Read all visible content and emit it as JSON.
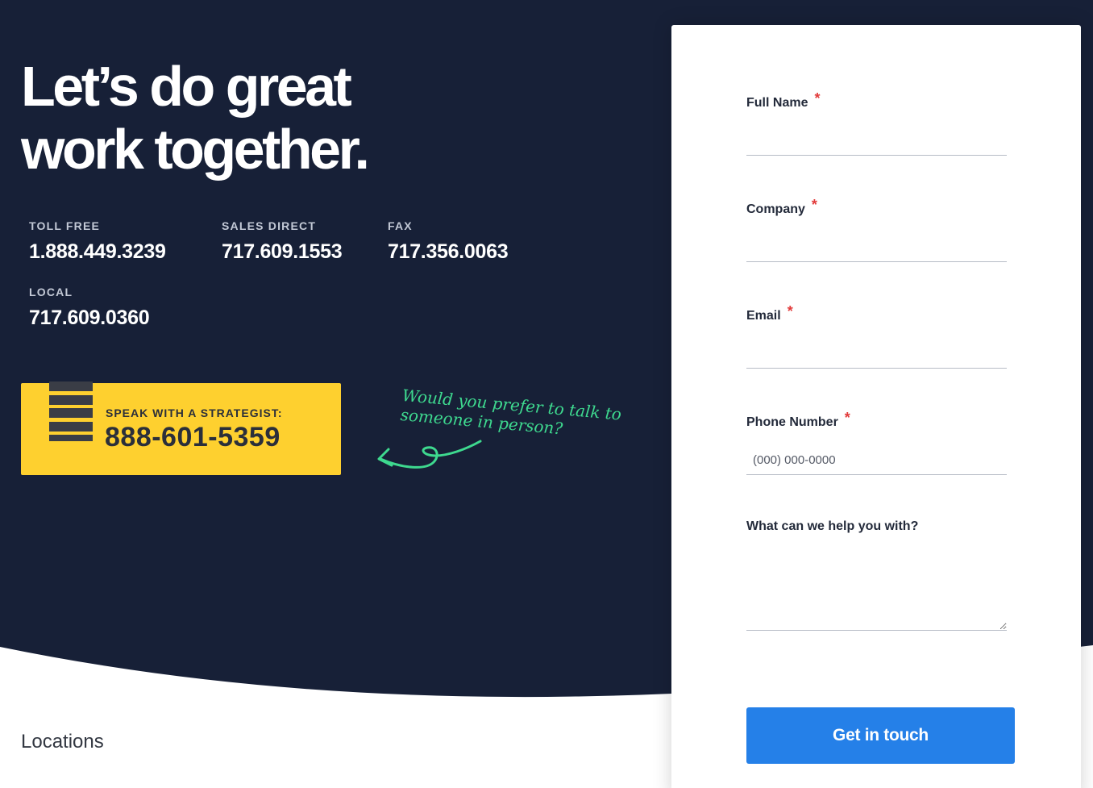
{
  "hero": {
    "headline_line1": "Let’s do great",
    "headline_line2": "work together."
  },
  "contacts": [
    {
      "label": "TOLL FREE",
      "number": "1.888.449.3239"
    },
    {
      "label": "SALES DIRECT",
      "number": "717.609.1553"
    },
    {
      "label": "FAX",
      "number": "717.356.0063"
    },
    {
      "label": "LOCAL",
      "number": "717.609.0360"
    }
  ],
  "strategist": {
    "label": "SPEAK WITH A STRATEGIST:",
    "number": "888-601-5359",
    "icon": "stack-icon"
  },
  "note": {
    "line1": "Would you prefer to talk to",
    "line2": "someone in person?"
  },
  "sections": {
    "locations": "Locations"
  },
  "form": {
    "full_name": {
      "label": "Full Name",
      "required_mark": "*",
      "value": ""
    },
    "company": {
      "label": "Company",
      "required_mark": "*",
      "value": ""
    },
    "email": {
      "label": "Email",
      "required_mark": "*",
      "value": ""
    },
    "phone": {
      "label": "Phone Number",
      "required_mark": "*",
      "placeholder": "(000) 000-0000"
    },
    "message": {
      "label": "What can we help you with?",
      "value": ""
    },
    "submit_label": "Get in touch"
  },
  "colors": {
    "hero_background": "#172037",
    "accent_yellow": "#fed02f",
    "accent_green": "#3ed98f",
    "button_blue": "#2580e8",
    "required_red": "#e23b3b"
  }
}
